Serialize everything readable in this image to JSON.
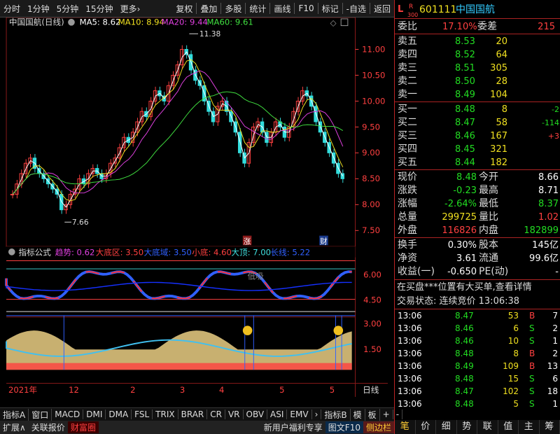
{
  "toolbar": {
    "left": [
      "分时",
      "1分钟",
      "5分钟",
      "15分钟",
      "更多›"
    ],
    "right": [
      "复权",
      "叠加",
      "多股",
      "统计",
      "画线",
      "F10",
      "标记",
      "-自选",
      "返回"
    ]
  },
  "kline": {
    "title": "中国国航(日线)",
    "ma5": "MA5: 8.62",
    "ma10": "MA10: 8.94",
    "ma20": "MA20: 9.44",
    "ma60": "MA60: 9.61",
    "high_marker": "11.38",
    "low_marker": "7.66",
    "yticks": [
      "11.00",
      "10.50",
      "10.00",
      "9.50",
      "9.00",
      "8.50",
      "8.00",
      "7.50"
    ],
    "flag_rise": "涨",
    "flag_fin": "财"
  },
  "indicator": {
    "name": "指标公式",
    "trend": "趋势: 0.62",
    "bigbottom_zone": "大底区: 3.50",
    "bigbottom_domain": "大底域: 3.50",
    "smallbottom": "小底: 4.60",
    "bigtop": "大顶: 7.00",
    "longline": "长线: 5.22",
    "low_buy": "低吸",
    "yticks_a": [
      "6.00",
      "4.50"
    ],
    "yticks_b": [
      "3.00",
      "1.50"
    ]
  },
  "dates": {
    "year": "2021年",
    "m12": "12",
    "m2": "2",
    "m3": "3",
    "m4": "4",
    "m5": "5",
    "label": "日线"
  },
  "bottom_tabs": [
    "指标A",
    "窗口",
    "MACD",
    "DMI",
    "DMA",
    "FSL",
    "TRIX",
    "BRAR",
    "CR",
    "VR",
    "OBV",
    "ASI",
    "EMV",
    "›",
    "指标B",
    "模",
    "板",
    "+",
    "-"
  ],
  "status": {
    "expand": "扩展∧",
    "related": "关联报价",
    "wealth": "财富圈",
    "promo": "新用户福利专享",
    "f10": "图文F10",
    "sidebar": "侧边栏"
  },
  "quote": {
    "L": "L",
    "R": "R",
    "idx": "300",
    "code": "601111",
    "name": "中国国航",
    "weibi_label": "委比",
    "weibi": "17.10%",
    "weicha_label": "委差",
    "weicha": "215",
    "sells": [
      {
        "label": "卖五",
        "price": "8.53",
        "vol": "20"
      },
      {
        "label": "卖四",
        "price": "8.52",
        "vol": "64"
      },
      {
        "label": "卖三",
        "price": "8.51",
        "vol": "305"
      },
      {
        "label": "卖二",
        "price": "8.50",
        "vol": "28"
      },
      {
        "label": "卖一",
        "price": "8.49",
        "vol": "104"
      }
    ],
    "buys": [
      {
        "label": "买一",
        "price": "8.48",
        "vol": "8",
        "chg": "-2"
      },
      {
        "label": "买二",
        "price": "8.47",
        "vol": "58",
        "chg": "-114"
      },
      {
        "label": "买三",
        "price": "8.46",
        "vol": "167",
        "chg": "+3"
      },
      {
        "label": "买四",
        "price": "8.45",
        "vol": "321",
        "chg": ""
      },
      {
        "label": "买五",
        "price": "8.44",
        "vol": "182",
        "chg": ""
      }
    ],
    "stats": [
      {
        "l1": "现价",
        "v1": "8.48",
        "l2": "今开",
        "v2": "8.66"
      },
      {
        "l1": "涨跌",
        "v1": "-0.23",
        "l2": "最高",
        "v2": "8.71"
      },
      {
        "l1": "涨幅",
        "v1": "-2.64%",
        "l2": "最低",
        "v2": "8.37"
      },
      {
        "l1": "总量",
        "v1": "299725",
        "l2": "量比",
        "v2": "1.02"
      },
      {
        "l1": "外盘",
        "v1": "116826",
        "l2": "内盘",
        "v2": "182899"
      }
    ],
    "stats2": [
      {
        "l1": "换手",
        "v1": "0.30%",
        "l2": "股本",
        "v2": "145亿"
      },
      {
        "l1": "净资",
        "v1": "3.61",
        "l2": "流通",
        "v2": "99.6亿"
      },
      {
        "l1": "收益(一)",
        "v1": "-0.650",
        "l2": "PE(动)",
        "v2": "-"
      }
    ],
    "notice": "在买盘***位置有大买单,查看详情",
    "trade_state": "交易状态: 连续竞价 13:06:38",
    "ticks": [
      {
        "t": "13:06",
        "p": "8.47",
        "v": "53",
        "d": "B",
        "n": "7"
      },
      {
        "t": "13:06",
        "p": "8.46",
        "v": "6",
        "d": "S",
        "n": "2"
      },
      {
        "t": "13:06",
        "p": "8.46",
        "v": "10",
        "d": "S",
        "n": "1"
      },
      {
        "t": "13:06",
        "p": "8.48",
        "v": "8",
        "d": "B",
        "n": "2"
      },
      {
        "t": "13:06",
        "p": "8.49",
        "v": "109",
        "d": "B",
        "n": "13"
      },
      {
        "t": "13:06",
        "p": "8.48",
        "v": "15",
        "d": "S",
        "n": "6"
      },
      {
        "t": "13:06",
        "p": "8.47",
        "v": "102",
        "d": "S",
        "n": "18"
      },
      {
        "t": "13:06",
        "p": "8.48",
        "v": "5",
        "d": "S",
        "n": "1"
      }
    ],
    "tabs": [
      "笔",
      "价",
      "细",
      "势",
      "联",
      "值",
      "主",
      "筹"
    ]
  }
}
